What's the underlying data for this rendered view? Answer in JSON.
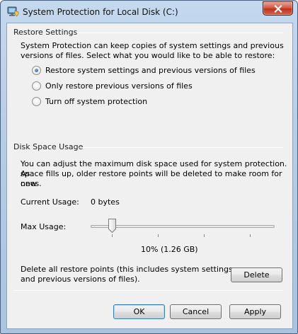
{
  "window": {
    "title": "System Protection for Local Disk (C:)"
  },
  "restore_settings": {
    "group_title": "Restore Settings",
    "description_line1": "System Protection can keep copies of system settings and previous",
    "description_line2": "versions of files. Select what you would like to be able to restore:",
    "options": [
      {
        "label": "Restore system settings and previous versions of files",
        "checked": true
      },
      {
        "label": "Only restore previous versions of files",
        "checked": false
      },
      {
        "label": "Turn off system protection",
        "checked": false
      }
    ]
  },
  "disk_space": {
    "group_title": "Disk Space Usage",
    "description_line1": "You can adjust the maximum disk space used for system protection. As",
    "description_line2": "space fills up, older restore points will be deleted to make room for new",
    "description_line3": "ones.",
    "current_usage_label": "Current Usage:",
    "current_usage_value": "0 bytes",
    "max_usage_label": "Max Usage:",
    "max_usage_percent": 10,
    "max_usage_display": "10% (1.26 GB)",
    "delete_text_line1": "Delete all restore points (this includes system settings",
    "delete_text_line2": "and previous versions of files).",
    "delete_label": "Delete"
  },
  "buttons": {
    "ok": "OK",
    "cancel": "Cancel",
    "apply": "Apply"
  },
  "colors": {
    "title_bar": "#b7cde6",
    "close_button": "#c7402b",
    "dialog_bg": "#f0f0f0",
    "default_button_border": "#3c7fb1"
  }
}
